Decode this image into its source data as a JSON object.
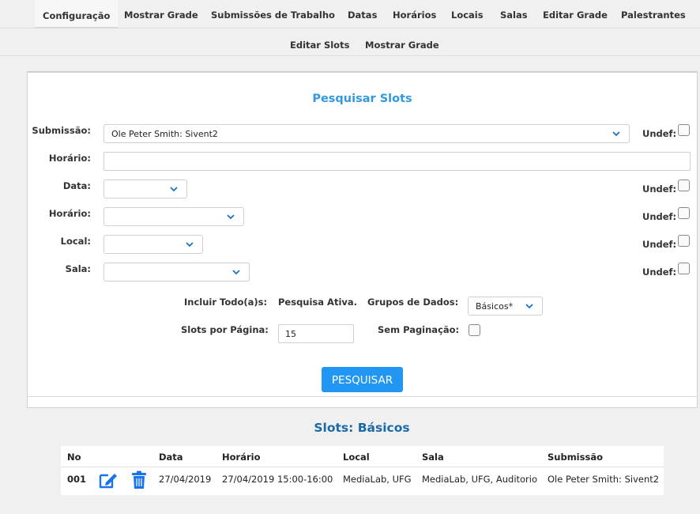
{
  "topnav": {
    "tabs": [
      "Configuração",
      "Mostrar Grade",
      "Submissões de Trabalho",
      "Datas",
      "Horários",
      "Locais",
      "Salas",
      "Editar Grade",
      "Palestrantes"
    ]
  },
  "subnav": {
    "tabs": [
      "Editar Slots",
      "Mostrar Grade"
    ]
  },
  "search": {
    "title": "Pesquisar Slots",
    "submission_label": "Submissão:",
    "submission_value": "Ole Peter Smith: Sivent2",
    "time_label": "Horário:",
    "time_value": "",
    "date_label": "Data:",
    "date_value": "",
    "schedule_label": "Horário:",
    "schedule_value": "",
    "place_label": "Local:",
    "place_value": "",
    "room_label": "Sala:",
    "room_value": "",
    "undef_label": "Undef:",
    "include_all_label": "Incluir Todo(a)s:",
    "active_search_text": "Pesquisa Ativa.",
    "data_groups_label": "Grupos de Dados:",
    "data_groups_value": "Básicos*",
    "per_page_label": "Slots por Página:",
    "per_page_value": "15",
    "no_paging_label": "Sem Paginação:",
    "search_button": "PESQUISAR"
  },
  "results": {
    "title": "Slots: Básicos",
    "columns": [
      "No",
      "Data",
      "Horário",
      "Local",
      "Sala",
      "Submissão"
    ],
    "rows": [
      {
        "no": "001",
        "date": "27/04/2019",
        "time": "27/04/2019 15:00-16:00",
        "place": "MediaLab, UFG",
        "room": "MediaLab, UFG, Auditorio",
        "submission": "Ole Peter Smith: Sivent2"
      }
    ]
  },
  "colors": {
    "accent": "#2196f3",
    "title_blue": "#3399dd",
    "results_blue": "#1a6aa8"
  }
}
